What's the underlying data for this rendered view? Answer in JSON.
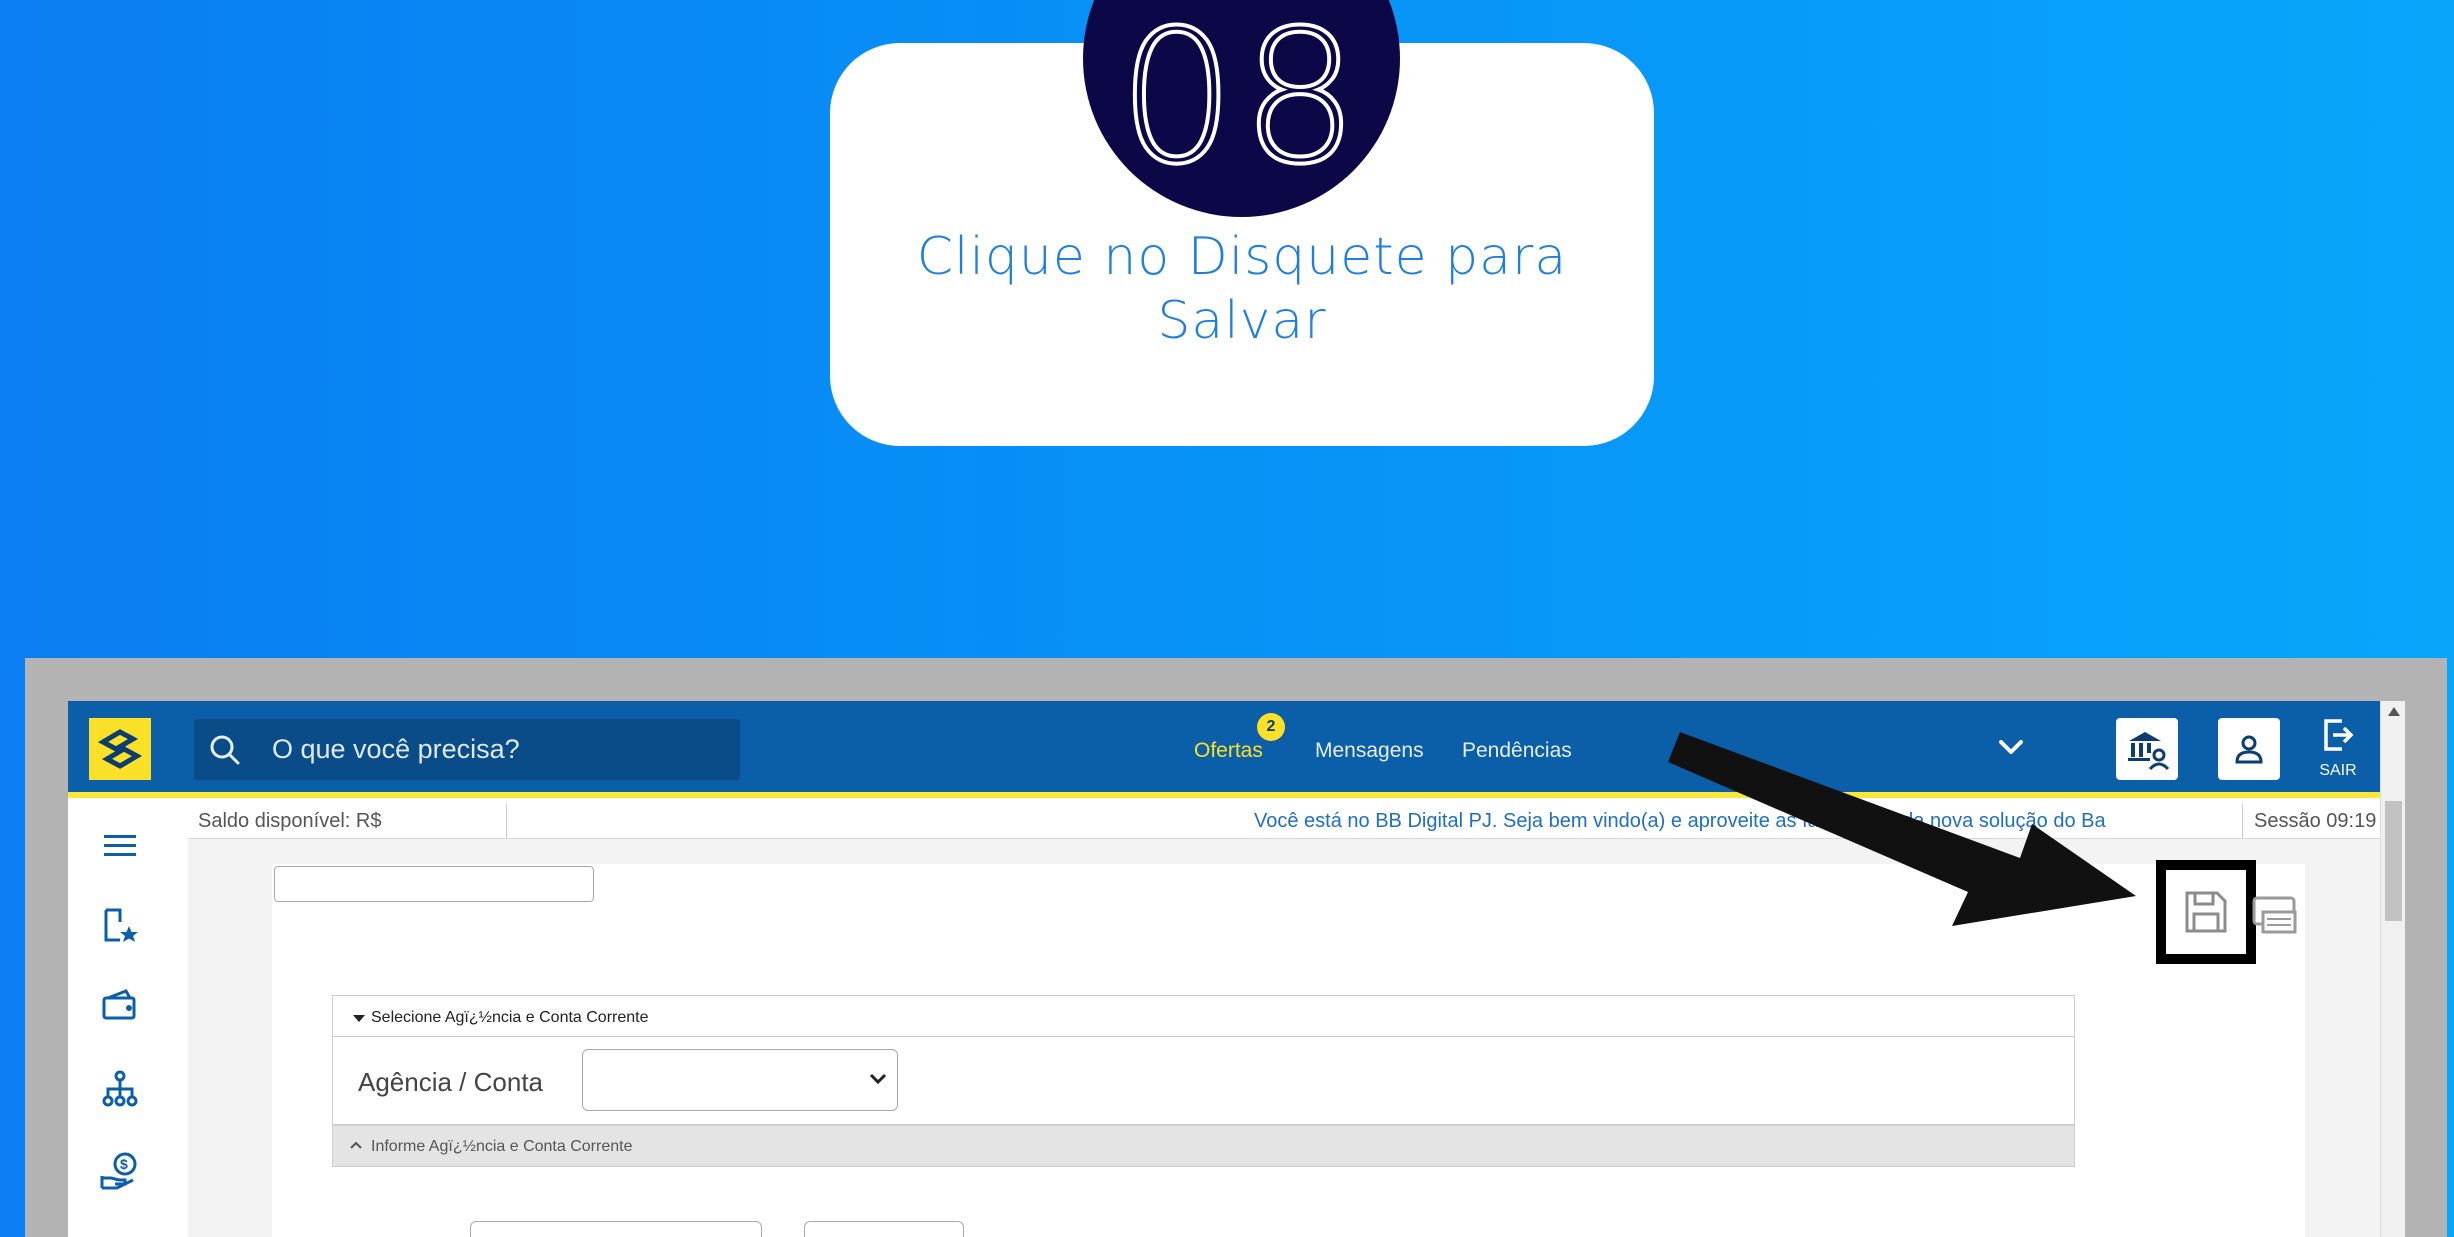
{
  "step": {
    "number": "08",
    "instruction": "Clique no Disquete para Salvar"
  },
  "topbar": {
    "search_placeholder": "O que você precisa?",
    "nav": [
      {
        "label": "Ofertas",
        "badge": "2"
      },
      {
        "label": "Mensagens"
      },
      {
        "label": "Pendências"
      }
    ],
    "sair_label": "SAIR"
  },
  "infobar": {
    "saldo_label": "Saldo disponível:",
    "saldo_currency": "R$",
    "marquee": "Você está no BB Digital PJ. Seja bem vindo(a) e aproveite as facilidades da nova solução do Ba",
    "session": "Sessão 09:19"
  },
  "form": {
    "section_title": "Selecione Agï¿½ncia e Conta Corrente",
    "agencia_label": "Agência / Conta",
    "agencia_value": "",
    "section_footer": "Informe Agï¿½ncia e Conta Corrente"
  },
  "icons": {
    "sidebar": [
      "menu-icon",
      "favorites-icon",
      "wallet-icon",
      "hierarchy-icon",
      "money-hand-icon"
    ],
    "save": "floppy-disk-icon",
    "print": "printer-icon"
  },
  "colors": {
    "background_left": "#0a7ef2",
    "background_right": "#07a6fb",
    "step_circle": "#0c0847",
    "instruction_text": "#1f7fe0",
    "topbar": "#0b5ea8",
    "brand_yellow": "#fae128",
    "arrow": "#111111"
  }
}
